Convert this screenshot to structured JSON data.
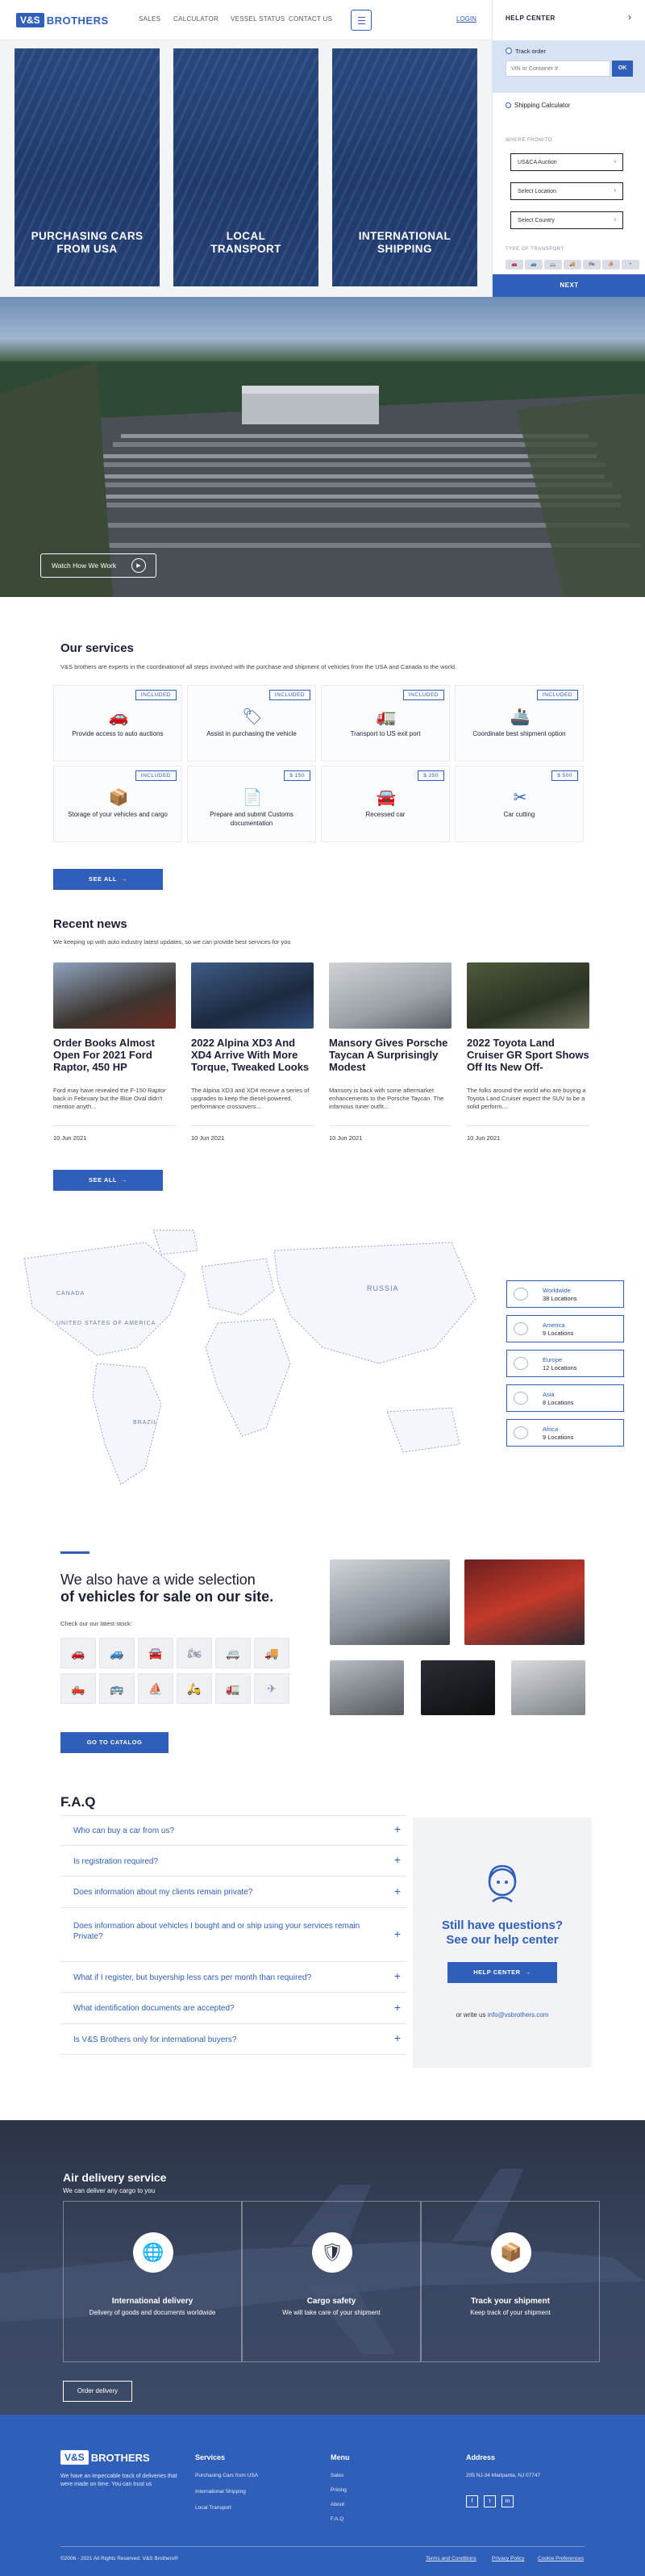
{
  "header": {
    "logo_mark": "V&S",
    "logo_text": "BROTHERS",
    "nav": [
      "SALES",
      "CALCULATOR",
      "VESSEL STATUS",
      "CONTACT US"
    ],
    "login": "LOGIN"
  },
  "hero_cards": [
    {
      "title": "PURCHASING CARS FROM USA"
    },
    {
      "title": "LOCAL TRANSPORT"
    },
    {
      "title": "INTERNATIONAL SHIPPING"
    }
  ],
  "help_panel": {
    "title": "HELP CENTER",
    "track_label": "Track order",
    "track_placeholder": "VIN or Container #",
    "track_button": "OK",
    "calc_label": "Shipping Calculator",
    "where_label": "WHERE FROM/TO",
    "selects": [
      "US&CA Auction",
      "Select Location",
      "Select Country"
    ],
    "transport_label": "TYPE OF TRANSPORT",
    "next": "NEXT"
  },
  "video": {
    "watch_label": "Watch How We Work"
  },
  "services": {
    "title": "Our services",
    "intro": "V&S brothers are experts in the coordinationof all steps involved with the purchase and shipment of vehicles from the USA and Canada to the world.",
    "items": [
      {
        "label": "Provide access to auto auctions",
        "tag": "INCLUDED"
      },
      {
        "label": "Assist in purchasing the vehicle",
        "tag": "INCLUDED"
      },
      {
        "label": "Transport to US exit port",
        "tag": "INCLUDED"
      },
      {
        "label": "Coordinate best shipment option",
        "tag": "INCLUDED"
      },
      {
        "label": "Storage of your vehicles and cargo",
        "tag": "INCLUDED"
      },
      {
        "label": "Prepare and submit Customs documentation",
        "tag": "$ 150"
      },
      {
        "label": "Recessed car",
        "tag": "$ 250"
      },
      {
        "label": "Car cutting",
        "tag": "$ 500"
      }
    ],
    "see_all": "SEE ALL"
  },
  "news": {
    "title": "Recent news",
    "subtitle": "We keeping up with auto industry latest updates, so we can provide best services for you",
    "items": [
      {
        "title": "Order Books Almost Open For 2021 Ford Raptor, 450 HP",
        "excerpt": "Ford may have revealed the F-150 Raptor back in February but the Blue Oval didn't mention anyth...",
        "date": "10 Jun 2021"
      },
      {
        "title": "2022 Alpina XD3 And XD4 Arrive With More Torque, Tweaked Looks",
        "excerpt": "The Alpina XD3 and XD4 receive a series of upgrades to keep the diesel-powered, performance crossovers...",
        "date": "10 Jun 2021"
      },
      {
        "title": "Mansory Gives Porsche Taycan A Surprisingly Modest",
        "excerpt": "Mansory is back with some aftermarket enhancements to the Porsche Taycan. The infamous tuner outfit...",
        "date": "10 Jun 2021"
      },
      {
        "title": "2022 Toyota Land Cruiser GR Sport Shows Off Its New Off-",
        "excerpt": "The folks around the world who are buying a Toyota Land Cruiser expect the SUV to be a solid perform...",
        "date": "10 Jun 2021"
      }
    ],
    "see_all": "SEE ALL"
  },
  "map": {
    "labels": [
      "CANADA",
      "UNITED STATES OF AMERICA",
      "BRAZIL",
      "RUSSIA"
    ],
    "regions": [
      {
        "name": "Worldwide",
        "count": "38 Locations"
      },
      {
        "name": "America",
        "count": "9 Locations"
      },
      {
        "name": "Europe",
        "count": "12 Locations"
      },
      {
        "name": "Asia",
        "count": "8 Locations"
      },
      {
        "name": "Africa",
        "count": "9 Locations"
      }
    ]
  },
  "vehicles": {
    "title_line1": "We also have a wide selection",
    "title_line2": "of vehicles for sale on our site.",
    "subtitle": "Check our our latest stock:",
    "catalog_button": "GO TO CATALOG"
  },
  "faq": {
    "title": "F.A.Q",
    "questions": [
      "Who can buy a car from us?",
      "Is registration required?",
      "Does information about my clients remain private?",
      "Does information about vehicles I bought and or ship using your services remain Private?",
      "What if I register, but buyership less cars per month than required?",
      "What identification documents are accepted?",
      "Is V&S Brothers only for international buyers?"
    ],
    "help_title_1": "Still have questions?",
    "help_title_2": "See our help center",
    "help_button": "HELP CENTER",
    "help_write_prefix": "or write us",
    "help_email": "info@vsbrothers.com"
  },
  "air": {
    "title": "Air delivery service",
    "subtitle": "We can deliver any cargo to you",
    "boxes": [
      {
        "title": "International delivery",
        "text": "Delivery of goods and documents worldwide",
        "icon": "globe-icon"
      },
      {
        "title": "Cargo safety",
        "text": "We will take care of your shipment",
        "icon": "shield-icon"
      },
      {
        "title": "Track your shipment",
        "text": "Keep track of your shipment",
        "icon": "track-icon"
      }
    ],
    "button": "Order delivery"
  },
  "footer": {
    "logo_mark": "V&S",
    "logo_text": "BROTHERS",
    "tagline": "We have an impeccable track of deliveries that were made on time. You can trust us",
    "services_title": "Services",
    "services": [
      "Purchasing Cars from USA",
      "International Shipping",
      "Local Transport"
    ],
    "menu_title": "Menu",
    "menu": [
      "Sales",
      "Pricing",
      "About",
      "F.A.Q"
    ],
    "address_title": "Address",
    "address": "205 NJ-34 Marlpanta, NJ 07747",
    "social": [
      "f",
      "t",
      "in"
    ],
    "copyright": "©2006 - 2021 All Rights Reserved. V&S Brothers®",
    "legal": [
      "Terms and Conditions",
      "Privacy Policy",
      "Cookie Preferences"
    ]
  },
  "colors": {
    "brand": "#2f5fb8",
    "dark": "#1a1f36",
    "air_bg": "#2b3347"
  }
}
